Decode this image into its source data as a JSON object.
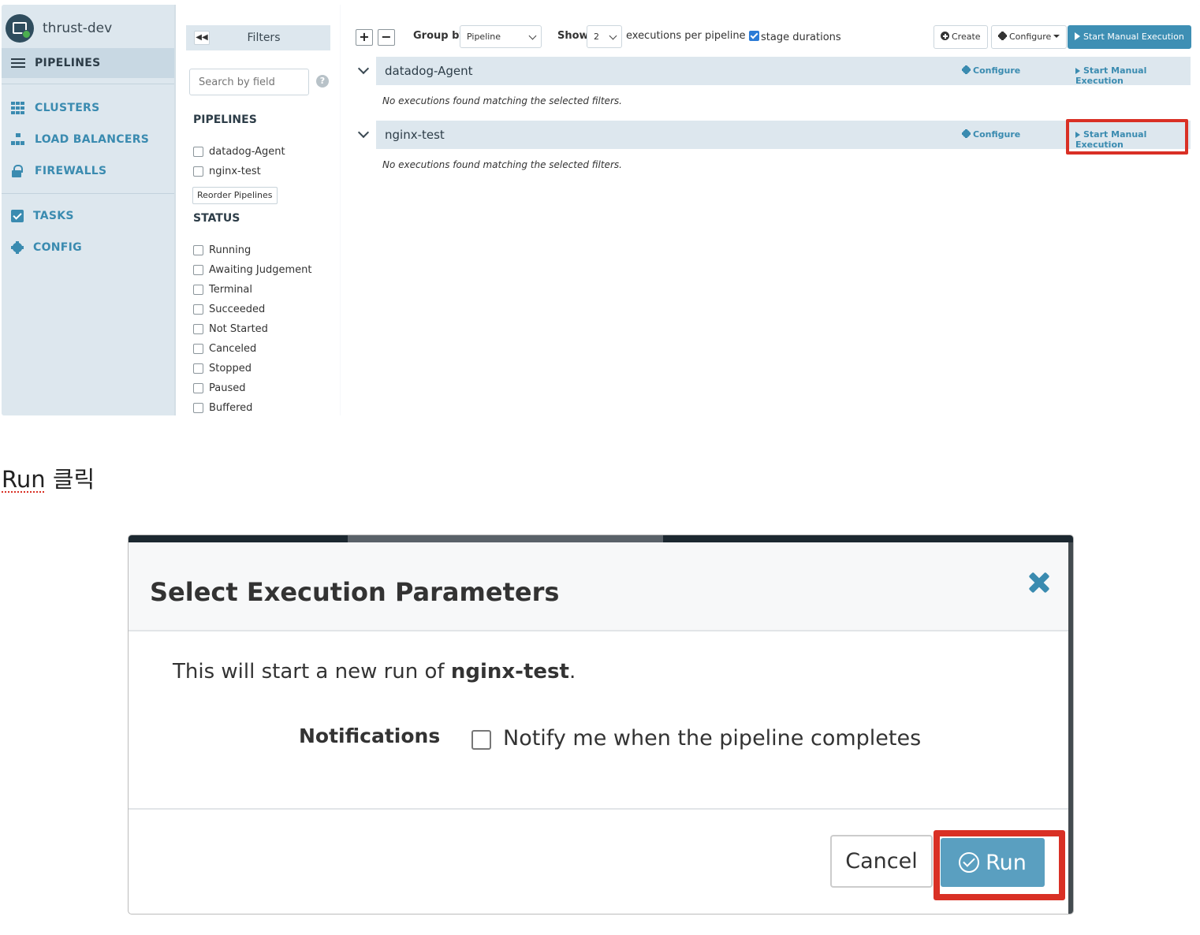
{
  "app": {
    "name": "thrust-dev"
  },
  "sidebar": {
    "items": [
      {
        "label": "PIPELINES",
        "icon": "list-icon",
        "active": true
      },
      {
        "label": "CLUSTERS",
        "icon": "grid-icon"
      },
      {
        "label": "LOAD BALANCERS",
        "icon": "sitemap-icon"
      },
      {
        "label": "FIREWALLS",
        "icon": "lock-icon"
      },
      {
        "label": "TASKS",
        "icon": "check-square-icon"
      },
      {
        "label": "CONFIG",
        "icon": "gear-icon"
      }
    ]
  },
  "filters": {
    "title": "Filters",
    "search_placeholder": "Search by field",
    "pipelines_heading": "PIPELINES",
    "pipelines": [
      "datadog-Agent",
      "nginx-test"
    ],
    "reorder_label": "Reorder Pipelines",
    "status_heading": "STATUS",
    "statuses": [
      "Running",
      "Awaiting Judgement",
      "Terminal",
      "Succeeded",
      "Not Started",
      "Canceled",
      "Stopped",
      "Paused",
      "Buffered"
    ]
  },
  "toolbar": {
    "group_by_label": "Group by",
    "group_by_value": "Pipeline",
    "show_label": "Show",
    "show_value": "2",
    "per_pipeline_label": "executions per pipeline",
    "stage_durations_label": "stage durations",
    "stage_durations_checked": true,
    "create_label": "Create",
    "configure_label": "Configure",
    "start_label": "Start Manual Execution"
  },
  "pipelines": [
    {
      "name": "datadog-Agent",
      "configure": "Configure",
      "start": "Start Manual Execution",
      "empty": "No executions found matching the selected filters."
    },
    {
      "name": "nginx-test",
      "configure": "Configure",
      "start": "Start Manual Execution",
      "empty": "No executions found matching the selected filters."
    }
  ],
  "caption": {
    "run": "Run",
    "rest": " 클릭"
  },
  "modal": {
    "title": "Select Execution Parameters",
    "body_prefix": "This will start a new run of ",
    "body_pipeline": "nginx-test",
    "body_suffix": ".",
    "notifications_label": "Notifications",
    "notify_text": "Notify me when the pipeline completes",
    "cancel_label": "Cancel",
    "run_label": "Run"
  },
  "colors": {
    "accent": "#3a8bb0",
    "highlight": "#d93025",
    "primary_button": "#3e8fb4"
  }
}
